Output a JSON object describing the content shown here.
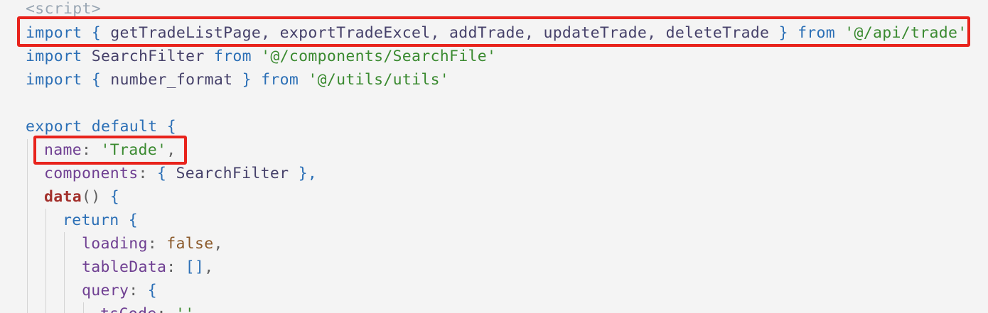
{
  "code": {
    "script_tag": "<script>",
    "import1": {
      "kw_import": "import",
      "open_brace": "{",
      "names": "getTradeListPage, exportTradeExcel, addTrade, updateTrade, deleteTrade",
      "close_brace": "}",
      "kw_from": "from",
      "path": "'@/api/trade'"
    },
    "import2": {
      "kw_import": "import",
      "name": "SearchFilter",
      "kw_from": "from",
      "path": "'@/components/SearchFile'"
    },
    "import3": {
      "kw_import": "import",
      "open_brace": "{",
      "name": "number_format",
      "close_brace": "}",
      "kw_from": "from",
      "path": "'@/utils/utils'"
    },
    "export_line": {
      "kw_export": "export",
      "kw_default": "default",
      "open_brace": "{"
    },
    "name_line": {
      "prop": "name",
      "colon": ":",
      "value": "'Trade'",
      "comma": ","
    },
    "components_line": {
      "prop": "components",
      "colon": ":",
      "open_brace": "{",
      "value": "SearchFilter",
      "close_brace": "},"
    },
    "data_line": {
      "fn": "data",
      "parens": "()",
      "open_brace": "{"
    },
    "return_line": {
      "kw_return": "return",
      "open_brace": "{"
    },
    "loading_line": {
      "prop": "loading",
      "colon": ":",
      "value": "false",
      "comma": ","
    },
    "tabledata_line": {
      "prop": "tableData",
      "colon": ":",
      "value": "[]",
      "comma": ","
    },
    "query_line": {
      "prop": "query",
      "colon": ":",
      "open_brace": "{"
    },
    "partial_line": {
      "prop": "tsCode",
      "colon": ":",
      "value": "''"
    }
  },
  "colors": {
    "highlight_border": "#e8231c",
    "background": "#f4f4f4"
  }
}
